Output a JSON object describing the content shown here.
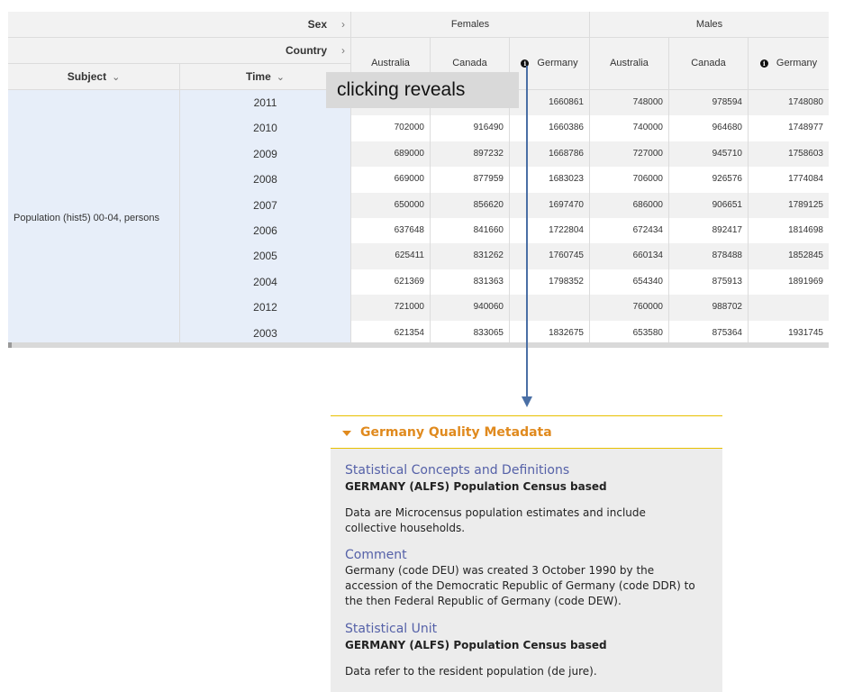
{
  "table": {
    "dims": {
      "sex": "Sex",
      "country": "Country",
      "subject": "Subject",
      "time": "Time"
    },
    "sex_groups": [
      "Females",
      "Males"
    ],
    "countries": [
      "Australia",
      "Canada",
      "Germany",
      "Australia",
      "Canada",
      "Germany"
    ],
    "subject_value": "Population (hist5) 00-04, persons",
    "rows": [
      {
        "time": "2011",
        "values": [
          "",
          "",
          "1660861",
          "748000",
          "978594",
          "1748080"
        ]
      },
      {
        "time": "2010",
        "values": [
          "702000",
          "916490",
          "1660386",
          "740000",
          "964680",
          "1748977"
        ]
      },
      {
        "time": "2009",
        "values": [
          "689000",
          "897232",
          "1668786",
          "727000",
          "945710",
          "1758603"
        ]
      },
      {
        "time": "2008",
        "values": [
          "669000",
          "877959",
          "1683023",
          "706000",
          "926576",
          "1774084"
        ]
      },
      {
        "time": "2007",
        "values": [
          "650000",
          "856620",
          "1697470",
          "686000",
          "906651",
          "1789125"
        ]
      },
      {
        "time": "2006",
        "values": [
          "637648",
          "841660",
          "1722804",
          "672434",
          "892417",
          "1814698"
        ]
      },
      {
        "time": "2005",
        "values": [
          "625411",
          "831262",
          "1760745",
          "660134",
          "878488",
          "1852845"
        ]
      },
      {
        "time": "2004",
        "values": [
          "621369",
          "831363",
          "1798352",
          "654340",
          "875913",
          "1891969"
        ]
      },
      {
        "time": "2012",
        "values": [
          "721000",
          "940060",
          "",
          "760000",
          "988702",
          ""
        ]
      },
      {
        "time": "2003",
        "values": [
          "621354",
          "833065",
          "1832675",
          "653580",
          "875364",
          "1931745"
        ]
      }
    ]
  },
  "overlay_label": "clicking  reveals",
  "metadata": {
    "title": "Germany Quality Metadata",
    "sections": [
      {
        "title": "Statistical Concepts and Definitions",
        "subtitle": "GERMANY (ALFS) Population Census based",
        "body": "Data are Microcensus population estimates and include\ncollective households."
      },
      {
        "title": "Comment",
        "subtitle": "",
        "body": "Germany (code DEU) was created 3 October 1990 by the\naccession of the Democratic Republic of Germany (code DDR) to\nthe then Federal Republic of Germany (code DEW)."
      },
      {
        "title": "Statistical Unit",
        "subtitle": "GERMANY (ALFS) Population Census based",
        "body": "Data refer to the resident population (de jure)."
      }
    ]
  },
  "colors": {
    "accent_orange": "#e08a1e",
    "section_blue": "#5561a8",
    "arrow_blue": "#4a6fa5",
    "row_header_bg": "#e7eef9"
  }
}
